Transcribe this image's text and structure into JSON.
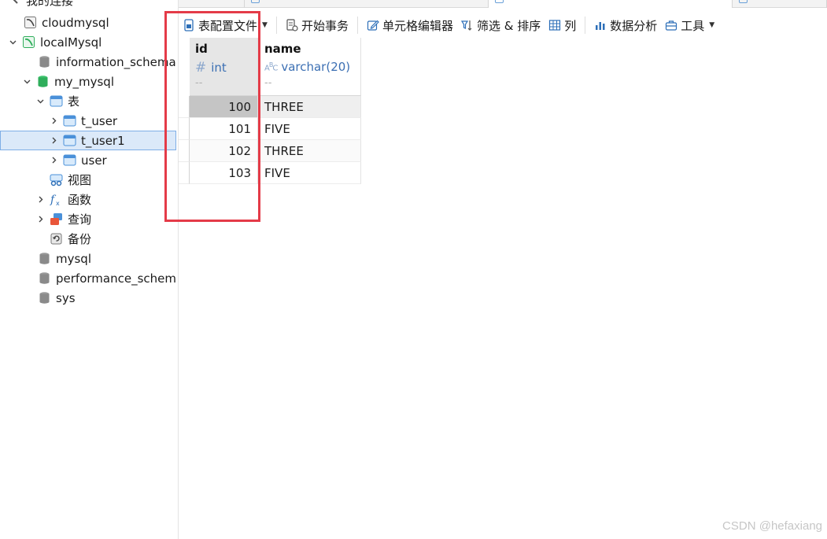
{
  "sidebar": {
    "items": [
      {
        "label": "我的连接",
        "icon": "connection-icon",
        "expanded": null
      },
      {
        "label": "cloudmysql",
        "icon": "mysql-connection-icon",
        "expanded": null
      },
      {
        "label": "localMysql",
        "icon": "mysql-connection-active-icon",
        "expanded": true
      },
      {
        "label": "information_schema",
        "icon": "database-icon",
        "expanded": null
      },
      {
        "label": "my_mysql",
        "icon": "database-active-icon",
        "expanded": true
      },
      {
        "label": "表",
        "icon": "tables-folder-icon",
        "expanded": true
      },
      {
        "label": "t_user",
        "icon": "table-icon",
        "expanded": false
      },
      {
        "label": "t_user1",
        "icon": "table-icon",
        "expanded": false,
        "selected": true
      },
      {
        "label": "user",
        "icon": "table-icon",
        "expanded": false
      },
      {
        "label": "视图",
        "icon": "views-icon",
        "expanded": null
      },
      {
        "label": "函数",
        "icon": "function-icon",
        "expanded": false
      },
      {
        "label": "查询",
        "icon": "query-icon",
        "expanded": false
      },
      {
        "label": "备份",
        "icon": "backup-icon",
        "expanded": null
      },
      {
        "label": "mysql",
        "icon": "database-icon",
        "expanded": null
      },
      {
        "label": "performance_schema",
        "icon": "database-icon",
        "expanded": null
      },
      {
        "label": "sys",
        "icon": "database-icon",
        "expanded": null
      }
    ]
  },
  "toolbar": {
    "table_config_label": "表配置文件",
    "begin_transaction_label": "开始事务",
    "cell_editor_label": "单元格编辑器",
    "filter_sort_label": "筛选 & 排序",
    "columns_label": "列",
    "data_analysis_label": "数据分析",
    "tools_label": "工具"
  },
  "grid": {
    "columns": [
      {
        "name": "id",
        "type": "int",
        "type_icon": "number-type-icon",
        "null_hint": "--"
      },
      {
        "name": "name",
        "type": "varchar(20)",
        "type_icon": "string-type-icon",
        "null_hint": "--"
      }
    ],
    "rows": [
      {
        "id": "100",
        "name": "THREE"
      },
      {
        "id": "101",
        "name": "FIVE"
      },
      {
        "id": "102",
        "name": "THREE"
      },
      {
        "id": "103",
        "name": "FIVE"
      }
    ]
  },
  "annotation": {
    "color": "#e43b48"
  },
  "watermark": "CSDN @hefaxiang",
  "colors": {
    "selection": "#dbe9f9",
    "type_text": "#3b6fb3",
    "db_green": "#2fae5b",
    "table_blue": "#4a90d9"
  }
}
